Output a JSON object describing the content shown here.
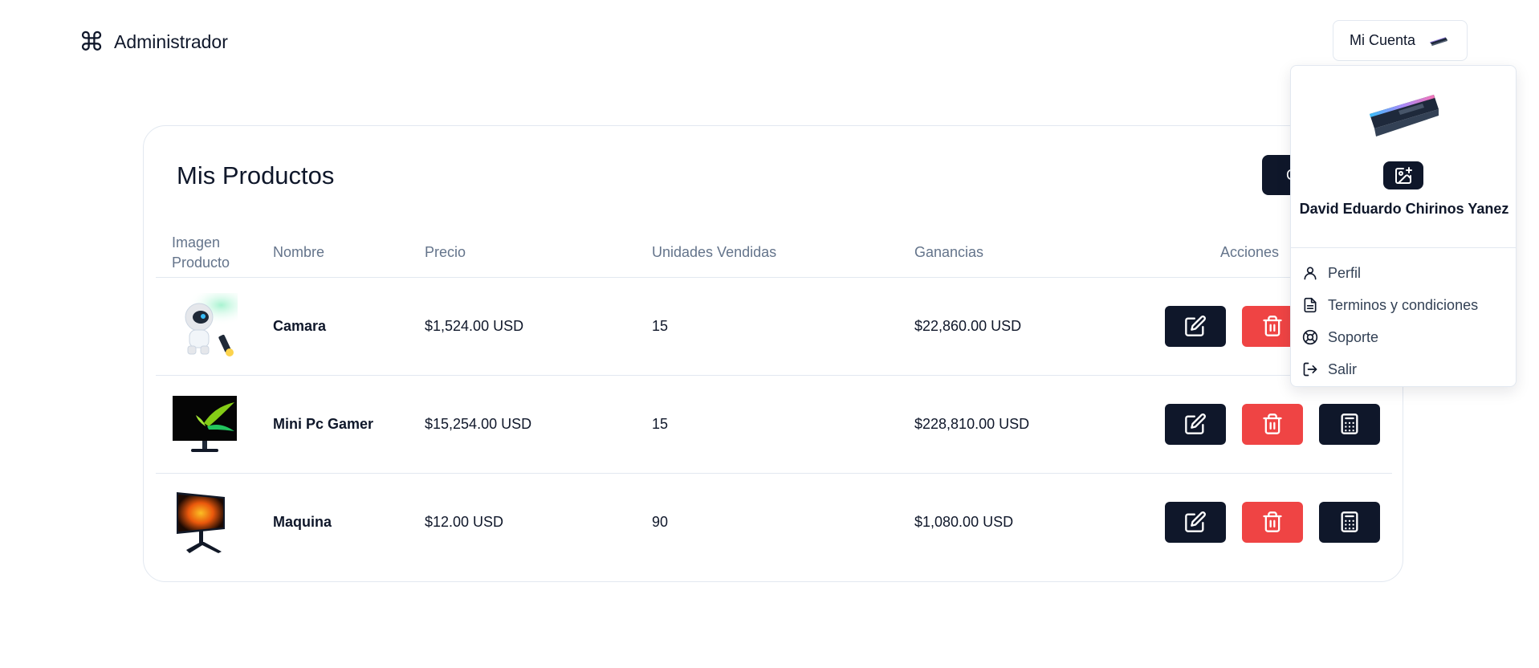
{
  "header": {
    "brand_icon": "command-icon",
    "brand_title": "Administrador",
    "account_label": "Mi Cuenta",
    "account_image": "ram-module-image"
  },
  "products": {
    "title": "Mis Productos",
    "create_label": "C",
    "columns": [
      "Imagen Producto",
      "Nombre",
      "Precio",
      "Unidades Vendidas",
      "Ganancias",
      "Acciones"
    ],
    "rows": [
      {
        "image": "astronaut-projector-image",
        "name": "Camara",
        "price": "$1,524.00 USD",
        "units": "15",
        "earnings": "$22,860.00 USD"
      },
      {
        "image": "monitor-image",
        "name": "Mini Pc Gamer",
        "price": "$15,254.00 USD",
        "units": "15",
        "earnings": "$228,810.00 USD"
      },
      {
        "image": "gaming-monitor-image",
        "name": "Maquina",
        "price": "$12.00 USD",
        "units": "90",
        "earnings": "$1,080.00 USD"
      }
    ],
    "actions": [
      "edit-icon",
      "trash-icon",
      "calculator-icon"
    ]
  },
  "dropdown": {
    "user_name": "David Eduardo Chirinos Yanez",
    "upload_icon": "image-upload-icon",
    "menu": [
      {
        "label": "Perfil",
        "icon": "user-icon"
      },
      {
        "label": "Terminos y condiciones",
        "icon": "document-icon"
      },
      {
        "label": "Soporte",
        "icon": "lifebuoy-icon"
      },
      {
        "label": "Salir",
        "icon": "logout-icon"
      }
    ]
  },
  "colors": {
    "primary": "#0f172a",
    "danger": "#ef4444",
    "muted": "#64748b",
    "border": "#e2e8f0"
  }
}
